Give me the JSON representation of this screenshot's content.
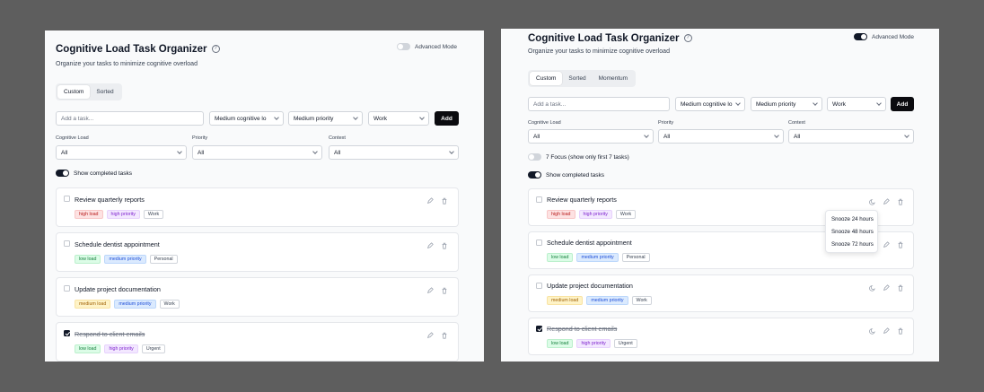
{
  "app": {
    "title": "Cognitive Load Task Organizer",
    "subtitle": "Organize your tasks to minimize cognitive overload",
    "help_glyph": "?",
    "advanced_mode_label": "Advanced Mode"
  },
  "tabs": [
    "Custom",
    "Sorted",
    "Momentum"
  ],
  "add_form": {
    "placeholder": "Add a task...",
    "load_value": "Medium cognitive lo",
    "priority_value": "Medium priority",
    "context_value": "Work",
    "add_label": "Add"
  },
  "filters": {
    "load_label": "Cognitive Load",
    "priority_label": "Priority",
    "context_label": "Context",
    "all": "All"
  },
  "focus_label": "7 Focus (show only first 7 tasks)",
  "show_completed_label": "Show completed tasks",
  "tasks": [
    {
      "title": "Review quarterly reports",
      "load": "high load",
      "priority": "high priority",
      "context": "Work"
    },
    {
      "title": "Schedule dentist appointment",
      "load": "low load",
      "priority": "medium priority",
      "context": "Personal"
    },
    {
      "title": "Update project documentation",
      "load": "medium load",
      "priority": "medium priority",
      "context": "Work"
    },
    {
      "title": "Respond to client emails",
      "load": "low load",
      "priority": "high priority",
      "context": "Urgent"
    }
  ],
  "snooze_menu": [
    "Snooze 24 hours",
    "Snooze 48 hours",
    "Snooze 72 hours"
  ],
  "colors": {
    "background": "#5e5e5e",
    "panel": "#f9fafb",
    "primary_button": "#0b0b0f",
    "high_load": "#fde2e2",
    "low_load": "#dcfce7",
    "medium_load": "#fef3c7",
    "high_priority": "#f3e8ff",
    "medium_priority": "#dbeafe"
  },
  "icons": [
    "help-icon",
    "pencil-icon",
    "trash-icon",
    "snooze-moon-icon",
    "chevron-down-icon",
    "checkbox-icon"
  ]
}
